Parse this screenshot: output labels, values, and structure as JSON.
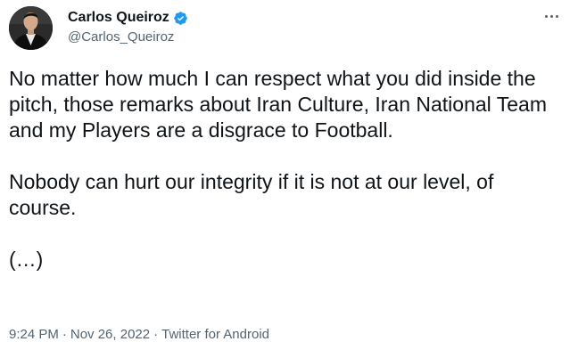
{
  "author": {
    "display_name": "Carlos Queiroz",
    "handle": "@Carlos_Queiroz",
    "verified": true,
    "avatar_icon": "profile-photo",
    "verified_color": "#1d9bf0"
  },
  "menu": {
    "icon": "more-horizontal-icon"
  },
  "tweet": {
    "paragraphs": [
      "No matter how much I can respect what you did inside the pitch, those remarks about Iran Culture, Iran National Team and my Players are a disgrace to Football.",
      "Nobody can hurt our integrity if it is not at our level, of course.",
      "(…)"
    ]
  },
  "meta": {
    "time": "9:24 PM",
    "date": "Nov 26, 2022",
    "separator": "·",
    "source": "Twitter for Android"
  },
  "colors": {
    "text_primary": "#0f1419",
    "text_secondary": "#536471",
    "accent": "#1d9bf0"
  }
}
